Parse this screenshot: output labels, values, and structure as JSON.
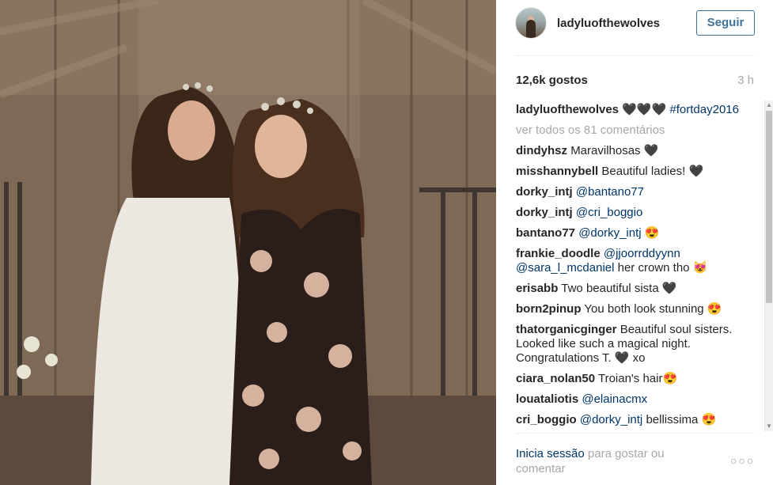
{
  "header": {
    "username": "ladyluofthewolves",
    "follow_label": "Seguir"
  },
  "stats": {
    "likes": "12,6k gostos",
    "time": "3 h"
  },
  "caption": {
    "username": "ladyluofthewolves",
    "text": "🖤🖤🖤",
    "hashtag": "#fortday2016"
  },
  "view_all": "ver todos os 81 comentários",
  "comments": [
    {
      "user": "dindyhsz",
      "link": "",
      "text": "Maravilhosas 🖤"
    },
    {
      "user": "misshannybell",
      "link": "",
      "text": "Beautiful ladies! 🖤"
    },
    {
      "user": "dorky_intj",
      "link": "@bantano77",
      "text": ""
    },
    {
      "user": "dorky_intj",
      "link": "@cri_boggio",
      "text": ""
    },
    {
      "user": "bantano77",
      "link": "@dorky_intj",
      "text": "😍"
    },
    {
      "user": "frankie_doodle",
      "link": "@jjoorrddyynn",
      "link2": "@sara_l_mcdaniel",
      "text": "her crown tho 😻"
    },
    {
      "user": "erisabb",
      "link": "",
      "text": "Two beautiful sista 🖤"
    },
    {
      "user": "born2pinup",
      "link": "",
      "text": "You both look stunning 😍"
    },
    {
      "user": "thatorganicginger",
      "link": "",
      "text": "Beautiful soul sisters. Looked like such a magical night. Congratulations T. 🖤 xo"
    },
    {
      "user": "ciara_nolan50",
      "link": "",
      "text": "Troian's hair😍"
    },
    {
      "user": "louataliotis",
      "link": "@elainacmx",
      "text": ""
    },
    {
      "user": "cri_boggio",
      "link": "@dorky_intj",
      "text": "bellissima 😍"
    }
  ],
  "footer": {
    "login_link": "Inicia sessão",
    "login_text": "para gostar ou comentar",
    "more": "○○○"
  }
}
